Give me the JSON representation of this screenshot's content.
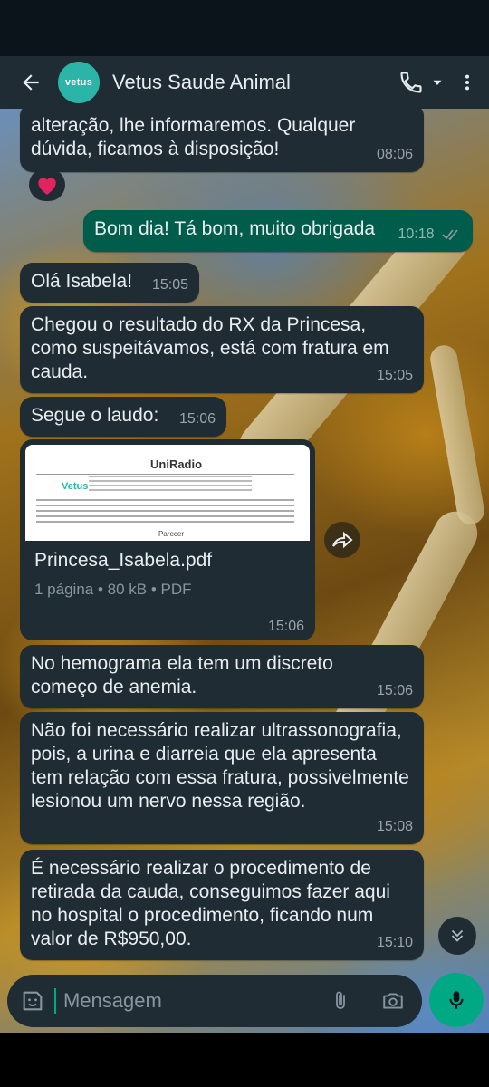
{
  "header": {
    "title": "Vetus Saude Animal",
    "avatar_text": "vetus"
  },
  "messages": [
    {
      "text": "alteração, lhe informaremos. Qualquer dúvida, ficamos à disposição!",
      "time": "08:06",
      "direction": "in"
    },
    {
      "text": "Bom dia! Tá bom, muito obrigada",
      "time": "10:18",
      "direction": "out"
    },
    {
      "text": "Olá Isabela!",
      "time": "15:05",
      "direction": "in"
    },
    {
      "text": "Chegou o resultado do RX da Princesa, como suspeitávamos, está com fratura em cauda.",
      "time": "15:05",
      "direction": "in"
    },
    {
      "text": "Segue o laudo:",
      "time": "15:06",
      "direction": "in"
    },
    {
      "text": "No hemograma ela tem um discreto começo de anemia.",
      "time": "15:06",
      "direction": "in"
    },
    {
      "text": "Não foi necessário realizar ultrassonografia, pois, a urina e diarreia que ela apresenta tem relação com essa fratura, possivelmente lesionou um nervo nessa região.",
      "time": "15:08",
      "direction": "in"
    },
    {
      "text": "É necessário realizar o procedimento de retirada da cauda, conseguimos fazer aqui no hospital o procedimento, ficando num valor de R$950,00.",
      "time": "15:10",
      "direction": "in"
    }
  ],
  "reaction": "❤️",
  "document": {
    "filename": "Princesa_Isabela.pdf",
    "meta": "1 página • 80 kB • PDF",
    "time": "15:06",
    "preview_brand": "UniRadio",
    "preview_logo": "Vetus",
    "preview_footer": "Parecer"
  },
  "composer": {
    "placeholder": "Mensagem"
  },
  "colors": {
    "header_bg": "#1f2c34",
    "incoming_bubble": "#1f2c34",
    "outgoing_bubble": "#005c4b",
    "accent": "#00a884",
    "avatar_bg": "#2bb5a8",
    "reaction_heart": "#e0245e",
    "read_ticks": "#8696a0"
  },
  "icons": {
    "back": "back-arrow-icon",
    "call": "phone-icon",
    "call_menu": "caret-down-icon",
    "menu": "more-vertical-icon",
    "forward": "forward-icon",
    "scroll_down": "double-chevron-down-icon",
    "emoji": "sticker-icon",
    "attach": "paperclip-icon",
    "camera": "camera-icon",
    "mic": "microphone-icon"
  }
}
